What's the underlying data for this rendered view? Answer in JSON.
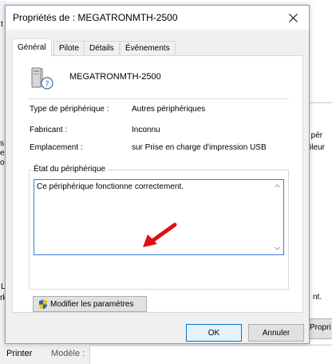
{
  "background": {
    "left_fragments": [
      "t",
      "s",
      "e",
      "on",
      "L",
      "rk"
    ],
    "right_panel_lines": [
      "pe",
      "res pér",
      "ntrôleur"
    ],
    "right_text": "nt.",
    "right_button": "Propri",
    "bottom": {
      "printer": "Printer",
      "model": "Modèle :"
    }
  },
  "dialog": {
    "title": "Propriétés de : MEGATRONMTH-2500",
    "tabs": [
      {
        "label": "Général",
        "active": true
      },
      {
        "label": "Pilote",
        "active": false
      },
      {
        "label": "Détails",
        "active": false
      },
      {
        "label": "Événements",
        "active": false
      }
    ],
    "device_name": "MEGATRONMTH-2500",
    "properties": {
      "type_label": "Type de périphérique :",
      "type_value": "Autres périphériques",
      "manufacturer_label": "Fabricant :",
      "manufacturer_value": "Inconnu",
      "location_label": "Emplacement :",
      "location_value": "sur Prise en charge d'impression USB"
    },
    "status_group_title": "État du périphérique",
    "status_text": "Ce périphérique fonctionne correctement.",
    "change_settings_label": "Modifier les paramètres",
    "ok_label": "OK",
    "cancel_label": "Annuler"
  },
  "colors": {
    "accent_border": "#3b7fd0",
    "arrow_red": "#e01010",
    "window_border": "#6ea3d8"
  },
  "icons": {
    "device": "device-unknown-icon",
    "shield": "uac-shield-icon",
    "close": "close-icon"
  }
}
